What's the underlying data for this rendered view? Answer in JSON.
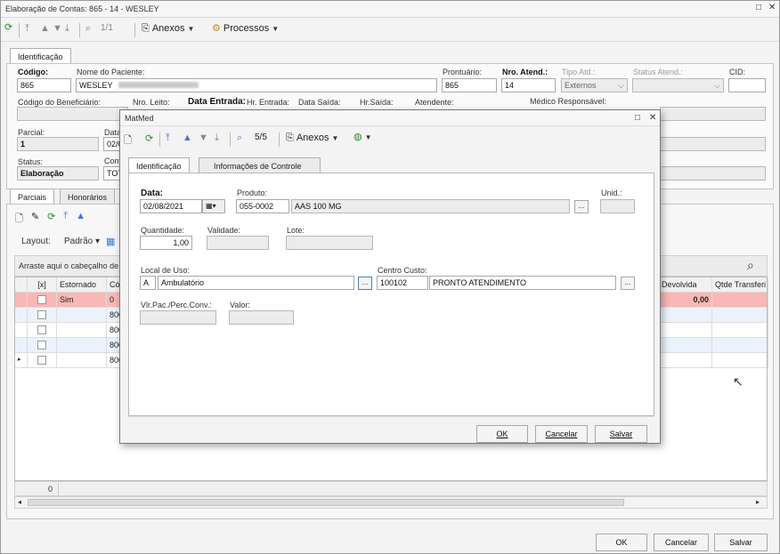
{
  "window": {
    "title": "Elaboração de Contas: 865 - 14 - WESLEY",
    "controls": [
      "□",
      "✕"
    ]
  },
  "toolbar": {
    "record_counter": "1/1",
    "anexos_label": "Anexos",
    "processos_label": "Processos"
  },
  "tabs_top": [
    "Identificação"
  ],
  "header": {
    "codigo_label": "Código:",
    "codigo_value": "865",
    "nome_label": "Nome do Paciente:",
    "nome_value": "WESLEY",
    "prontuario_label": "Prontuário:",
    "prontuario_value": "865",
    "nro_atend_label": "Nro. Atend.:",
    "nro_atend_value": "14",
    "tipo_atd_label": "Tipo Atd.:",
    "tipo_atd_value": "Externos",
    "status_atend_label": "Status Atend.:",
    "status_atend_value": "",
    "cid_label": "CID:",
    "cid_value": "",
    "cod_benef_label": "Código do Beneficiário:",
    "nro_leito_label": "Nro. Leito:",
    "data_entrada_label": "Data Entrada:",
    "hr_entrada_label": "Hr. Entrada:",
    "data_saida_label": "Data Saída:",
    "hr_saida_label": "Hr.Saída:",
    "atendente_label": "Atendente:",
    "medico_label": "Médico Responsável:",
    "parcial_label": "Parcial:",
    "parcial_value": "1",
    "data_label_short": "Data",
    "data_value_short": "02/0",
    "status_label": "Status:",
    "status_value": "Elaboração",
    "conv_label_short": "Conv",
    "conv_value_short": "TOT"
  },
  "subtabs": [
    "Parciais",
    "Honorários"
  ],
  "grid_toolbar": {
    "layout_label": "Layout:",
    "padrao_label": "Padrão"
  },
  "grid": {
    "group_hint": "Arraste aqui o cabeçalho de",
    "columns": [
      "[x]",
      "Estornado",
      "Cód",
      "Devolvida",
      "Qtde Transferi"
    ],
    "rows": [
      {
        "estornado": "Sim",
        "cod": "0",
        "devolvida": "0,00",
        "highlight": true
      },
      {
        "estornado": "",
        "cod": "800",
        "devolvida": "",
        "highlight": false
      },
      {
        "estornado": "",
        "cod": "800",
        "devolvida": "",
        "highlight": false
      },
      {
        "estornado": "",
        "cod": "800",
        "devolvida": "",
        "highlight": false
      },
      {
        "estornado": "",
        "cod": "800",
        "devolvida": "",
        "highlight": false
      }
    ],
    "footer_count": "0"
  },
  "bottom_buttons": {
    "ok": "OK",
    "cancelar": "Cancelar",
    "salvar": "Salvar"
  },
  "dialog": {
    "title": "MatMed",
    "record_counter": "5/5",
    "anexos_label": "Anexos",
    "tabs": [
      "Identificação",
      "Informações de Controle"
    ],
    "data_label": "Data:",
    "data_value": "02/08/2021",
    "produto_label": "Produto:",
    "produto_code": "055-0002",
    "produto_desc": "AAS 100 MG",
    "unid_label": "Unid.:",
    "quantidade_label": "Quantidade:",
    "quantidade_value": "1,00",
    "validade_label": "Validade:",
    "lote_label": "Lote:",
    "local_label": "Local de Uso:",
    "local_code": "A",
    "local_desc": "Ambulatório",
    "centro_label": "Centro Custo:",
    "centro_code": "100102",
    "centro_desc": "PRONTO ATENDIMENTO",
    "vlr_label": "Vlr.Pac./Perc.Conv.:",
    "valor_label": "Valor:",
    "ok": "OK",
    "cancelar": "Cancelar",
    "salvar": "Salvar",
    "lookup": "..."
  }
}
